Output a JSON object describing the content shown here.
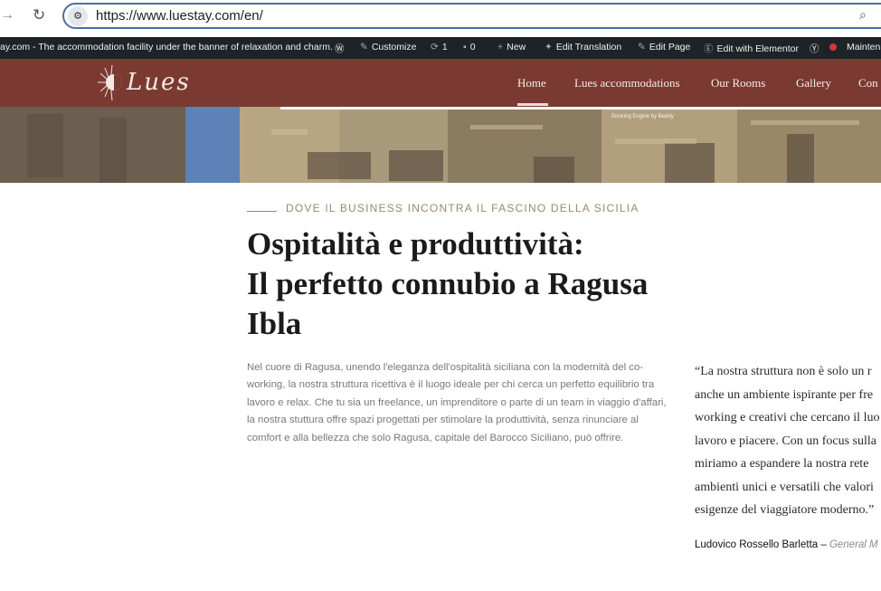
{
  "browser": {
    "url": "https://www.luestay.com/en/"
  },
  "admin_bar": {
    "site_text": "ay.com - The accommodation facility under the banner of relaxation and charm.",
    "customize": "Customize",
    "updates": "1",
    "comments": "0",
    "new": "New",
    "edit_translation": "Edit Translation",
    "edit_page": "Edit Page",
    "edit_elementor": "Edit with Elementor",
    "maintenance": "Mainten"
  },
  "header": {
    "logo_text": "Lues",
    "nav": [
      "Home",
      "Lues accommodations",
      "Our Rooms",
      "Gallery",
      "Con"
    ]
  },
  "hero": {
    "booking_text": "Booking Engine by Beddy"
  },
  "intro": {
    "eyebrow": "DOVE IL BUSINESS INCONTRA IL FASCINO DELLA SICILIA",
    "title_line1": "Ospitalità e produttività:",
    "title_line2": "Il perfetto connubio a Ragusa",
    "title_line3": "Ibla",
    "body": "Nel cuore di Ragusa, unendo l'eleganza dell'ospitalità siciliana con la modernità del co-working, la nostra struttura ricettiva è il luogo ideale per chi cerca un perfetto equilibrio tra lavoro e relax. Che tu sia un freelance, un imprenditore o parte di un team in viaggio d'affari, la nostra stuttura offre spazi progettati per stimolare la produttività, senza rinunciare al comfort e alla bellezza che solo Ragusa, capitale del Barocco Siciliano, può offrire."
  },
  "quote": {
    "lines": [
      "“La nostra struttura non è solo un r",
      "anche un ambiente ispirante per fre",
      "working e creativi che cercano il luo",
      "lavoro e piacere. Con un focus sulla",
      "miriamo a espandere la nostra rete",
      "ambienti unici e versatili che valori",
      "esigenze del viaggiatore moderno.”"
    ],
    "author": "Ludovico Rossello Barletta –",
    "role": "General M"
  }
}
